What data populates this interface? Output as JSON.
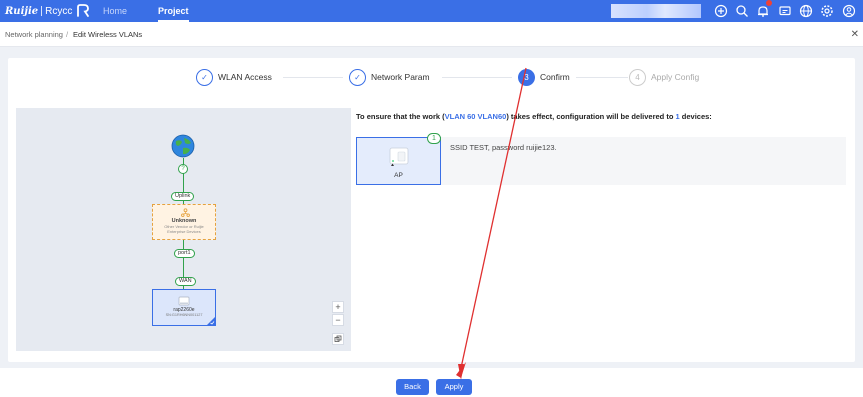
{
  "header": {
    "logo_brand": "Ruijie",
    "logo_product": "Rcycc",
    "nav": {
      "home": "Home",
      "project": "Project"
    },
    "icons": [
      "add-circle-icon",
      "search-icon",
      "bell-icon",
      "message-icon",
      "globe-icon",
      "settings-icon",
      "user-icon"
    ],
    "colors": {
      "primary": "#3a6fe6",
      "badge": "#f04134"
    }
  },
  "breadcrumb": {
    "parent": "Network planning",
    "separator": "/",
    "current": "Edit Wireless VLANs"
  },
  "steps": [
    {
      "num": "1",
      "label": "WLAN Access",
      "state": "done"
    },
    {
      "num": "2",
      "label": "Network Param",
      "state": "done"
    },
    {
      "num": "3",
      "label": "Confirm",
      "state": "active"
    },
    {
      "num": "4",
      "label": "Apply Config",
      "state": "wait"
    }
  ],
  "topology": {
    "question_mark": "?",
    "uplink_label": "Uplink",
    "unknown_title": "Unknown",
    "unknown_sub1": "Other Vendor or Ruijie",
    "unknown_sub2": "Enterprise Devices",
    "port_label": "port1",
    "wan_label": "WAN",
    "device_model": "rap2260e",
    "device_sn": "SN:G1RH6NN001127",
    "zoom_in": "+",
    "zoom_out": "−"
  },
  "description": {
    "prefix": "To ensure that the work (",
    "vlans": "VLAN 60 VLAN60",
    "middle": ") takes effect, configuration will be delivered to ",
    "count": "1",
    "suffix": " devices:"
  },
  "device_card": {
    "count": "1",
    "label": "AP",
    "ssid_text": "SSID TEST, password ruijie123."
  },
  "footer": {
    "back": "Back",
    "apply": "Apply"
  }
}
